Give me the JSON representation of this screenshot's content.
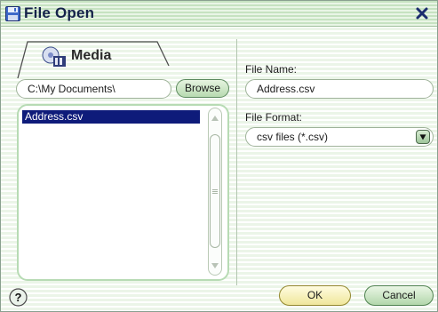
{
  "window": {
    "title": "File Open",
    "title_icon": "floppy-disk-icon",
    "close_icon": "close-icon"
  },
  "left_panel": {
    "tab_label": "Media",
    "tab_icon": "media-icon",
    "path_value": "C:\\My Documents\\",
    "browse_label": "Browse",
    "files": [
      "Address.csv"
    ],
    "selected_file": "Address.csv"
  },
  "right_panel": {
    "file_name_label": "File Name:",
    "file_name_value": "Address.csv",
    "file_format_label": "File Format:",
    "file_format_value": "csv files (*.csv)"
  },
  "footer": {
    "help_icon": "help-icon",
    "ok_label": "OK",
    "cancel_label": "Cancel"
  },
  "colors": {
    "selection": "#0e1b7a",
    "title_text": "#15224a",
    "ok_button": "#efe69b",
    "button_green": "#b2d7ab"
  }
}
